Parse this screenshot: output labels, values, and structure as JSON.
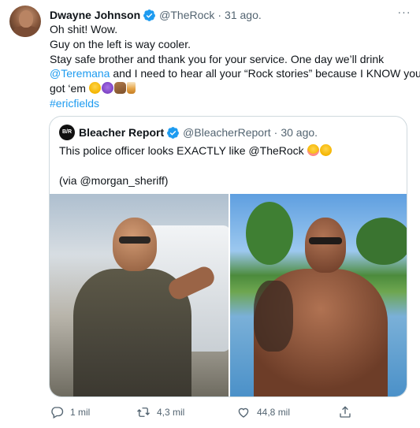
{
  "tweet": {
    "author_name": "Dwayne Johnson",
    "author_handle": "@TheRock",
    "separator": "·",
    "time": "31 ago.",
    "more_label": "···",
    "lines": {
      "l1": "Oh shit! Wow.",
      "l2": "Guy on the left is way cooler.",
      "l3": "Stay safe brother and thank you for your service. One day we’ll drink",
      "l4_link": "@Teremana",
      "l4_rest": " and I need to hear all your “Rock stories” because I KNOW you",
      "l5": "got ‘em ",
      "hashtag": "#ericfields"
    },
    "emojis": [
      "face-with-tears-of-joy",
      "smiling-face-with-horns",
      "left-facing-fist",
      "tumbler-glass"
    ]
  },
  "quoted_tweet": {
    "avatar_text": "B/R",
    "author_name": "Bleacher Report",
    "author_handle": "@BleacherReport",
    "separator": "·",
    "time": "30 ago.",
    "line1": "This police officer looks EXACTLY like @TheRock ",
    "line2": "",
    "line3": "(via @morgan_sheriff)",
    "emojis": [
      "flushed-face",
      "face-with-tears-of-joy"
    ],
    "photos": [
      "police-officer-photo",
      "the-rock-photo"
    ]
  },
  "actions": {
    "reply_count": "1 mil",
    "retweet_count": "4,3 mil",
    "like_count": "44,8 mil"
  },
  "colors": {
    "link": "#1d9bf0",
    "secondary_text": "#536471",
    "border": "#cfd9de",
    "verified": "#1d9bf0"
  }
}
